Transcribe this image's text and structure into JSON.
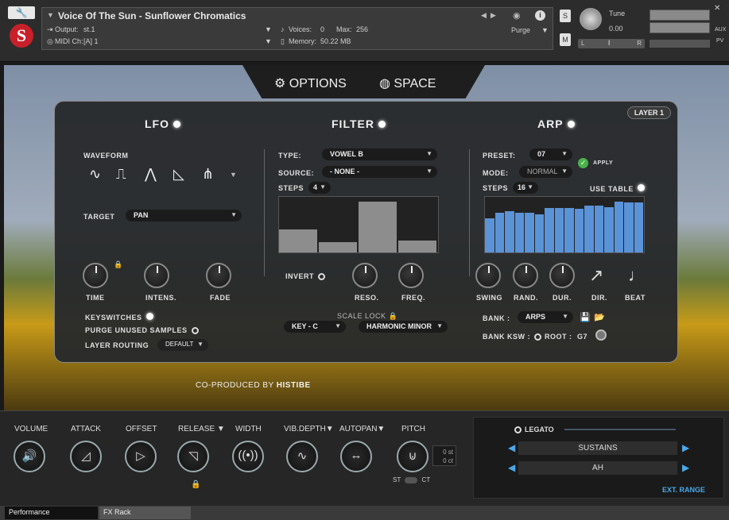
{
  "header": {
    "instrument_title": "Voice Of The Sun - Sunflower Chromatics",
    "output_label": "Output:",
    "output_value": "st.1",
    "midi_label": "MIDI Ch:",
    "midi_value": "[A] 1",
    "voices_label": "Voices:",
    "voices_value": "0",
    "max_label": "Max:",
    "max_value": "256",
    "memory_label": "Memory:",
    "memory_value": "50.22 MB",
    "purge_label": "Purge",
    "s_label": "S",
    "m_label": "M",
    "tune_label": "Tune",
    "tune_value": "0.00",
    "aux_label": "AUX",
    "pv_label": "PV",
    "pan_l": "L",
    "pan_r": "R"
  },
  "tabs": {
    "options": "OPTIONS",
    "space": "SPACE"
  },
  "layer": "LAYER 1",
  "lfo": {
    "title": "LFO",
    "waveform_label": "WAVEFORM",
    "waveforms": [
      "∿",
      "⎍",
      "⋀",
      "◺",
      "⋔"
    ],
    "target_label": "TARGET",
    "target_value": "PAN",
    "knobs": [
      "TIME",
      "INTENS.",
      "FADE"
    ],
    "keyswitches": "KEYSWITCHES",
    "purge_unused": "PURGE UNUSED SAMPLES",
    "layer_routing": "LAYER ROUTING",
    "layer_routing_value": "DEFAULT"
  },
  "filter": {
    "title": "FILTER",
    "type_label": "TYPE:",
    "type_value": "VOWEL B",
    "source_label": "SOURCE:",
    "source_value": "- NONE -",
    "steps_label": "STEPS",
    "steps_value": "4",
    "step_levels": [
      0.42,
      0.18,
      0.92,
      0.22
    ],
    "invert": "INVERT",
    "knobs": [
      "RESO.",
      "FREQ."
    ],
    "scale_lock": "SCALE LOCK",
    "key_value": "KEY - C",
    "scale_value": "HARMONIC MINOR"
  },
  "arp": {
    "title": "ARP",
    "preset_label": "PRESET:",
    "preset_value": "07",
    "apply": "APPLY",
    "mode_label": "MODE:",
    "mode_value": "NORMAL",
    "steps_label": "STEPS",
    "steps_value": "16",
    "use_table": "USE TABLE",
    "step_levels": [
      0.62,
      0.72,
      0.75,
      0.72,
      0.72,
      0.68,
      0.8,
      0.8,
      0.8,
      0.78,
      0.85,
      0.85,
      0.82,
      0.92,
      0.9,
      0.9
    ],
    "knobs": [
      "SWING",
      "RAND.",
      "DUR."
    ],
    "dir": "DIR.",
    "beat": "BEAT",
    "bank_label": "BANK :",
    "bank_value": "ARPS",
    "bank_ksw": "BANK KSW :",
    "root_label": "ROOT :",
    "root_value": "G7"
  },
  "coproduced": "CO-PRODUCED BY",
  "coproduced_name": "HISTIBE",
  "bottom": {
    "knobs": [
      "VOLUME",
      "ATTACK",
      "OFFSET",
      "RELEASE",
      "WIDTH",
      "VIB.DEPTH",
      "AUTOPAN",
      "PITCH"
    ],
    "pitch_st": "0 st",
    "pitch_ct": "0 ct",
    "st_label": "ST",
    "ct_label": "CT",
    "legato": "LEGATO",
    "sustains": "SUSTAINS",
    "ah": "AH",
    "ext_range": "EXT. RANGE"
  },
  "statusbar": {
    "performance": "Performance",
    "fx_rack": "FX Rack"
  },
  "colors": {
    "accent_blue": "#5a93d8",
    "knob_ring": "#9aa9b3"
  }
}
